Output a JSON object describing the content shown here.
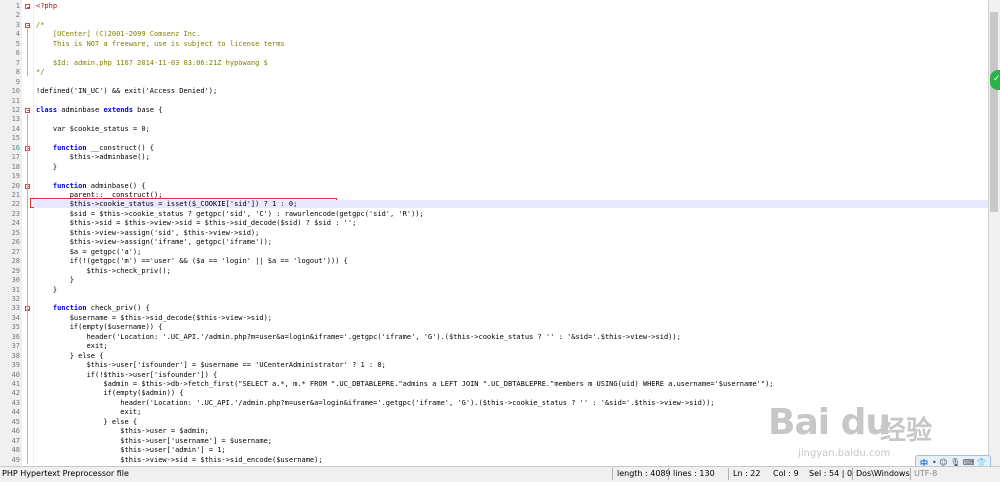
{
  "editor": {
    "lines": [
      {
        "n": "1",
        "t": "<?php",
        "c": "php"
      },
      {
        "n": "2",
        "t": "",
        "c": ""
      },
      {
        "n": "3",
        "t": "/*",
        "c": "com"
      },
      {
        "n": "4",
        "t": "    [UCenter] (C)2001-2099 Comsenz Inc.",
        "c": "com"
      },
      {
        "n": "5",
        "t": "    This is NOT a freeware, use is subject to license terms",
        "c": "com"
      },
      {
        "n": "6",
        "t": "",
        "c": ""
      },
      {
        "n": "7",
        "t": "    $Id: admin.php 1167 2014-11-03 03:06:21Z hypowang $",
        "c": "com"
      },
      {
        "n": "8",
        "t": "*/",
        "c": "com"
      },
      {
        "n": "9",
        "t": "",
        "c": ""
      },
      {
        "n": "10",
        "t": "!defined('IN_UC') && exit('Access Denied');",
        "c": ""
      },
      {
        "n": "11",
        "t": "",
        "c": ""
      },
      {
        "n": "12",
        "t": "class adminbase extends base {",
        "c": "kw"
      },
      {
        "n": "13",
        "t": "",
        "c": ""
      },
      {
        "n": "14",
        "t": "    var $cookie_status = 0;",
        "c": ""
      },
      {
        "n": "15",
        "t": "",
        "c": ""
      },
      {
        "n": "16",
        "t": "    function __construct() {",
        "c": "kw"
      },
      {
        "n": "17",
        "t": "        $this->adminbase();",
        "c": ""
      },
      {
        "n": "18",
        "t": "    }",
        "c": ""
      },
      {
        "n": "19",
        "t": "",
        "c": ""
      },
      {
        "n": "20",
        "t": "    function adminbase() {",
        "c": "kw"
      },
      {
        "n": "21",
        "t": "        parent::__construct();",
        "c": ""
      },
      {
        "n": "22",
        "t": "        $this->cookie_status = isset($_COOKIE['sid']) ? 1 : 0;",
        "c": ""
      },
      {
        "n": "23",
        "t": "        $sid = $this->cookie_status ? getgpc('sid', 'C') : rawurlencode(getgpc('sid', 'R'));",
        "c": ""
      },
      {
        "n": "24",
        "t": "        $this->sid = $this->view->sid = $this->sid_decode($sid) ? $sid : '';",
        "c": ""
      },
      {
        "n": "25",
        "t": "        $this->view->assign('sid', $this->view->sid);",
        "c": ""
      },
      {
        "n": "26",
        "t": "        $this->view->assign('iframe', getgpc('iframe'));",
        "c": ""
      },
      {
        "n": "27",
        "t": "        $a = getgpc('a');",
        "c": ""
      },
      {
        "n": "28",
        "t": "        if(!(getgpc('m') =='user' && ($a == 'login' || $a == 'logout'))) {",
        "c": ""
      },
      {
        "n": "29",
        "t": "            $this->check_priv();",
        "c": ""
      },
      {
        "n": "30",
        "t": "        }",
        "c": ""
      },
      {
        "n": "31",
        "t": "    }",
        "c": ""
      },
      {
        "n": "32",
        "t": "",
        "c": ""
      },
      {
        "n": "33",
        "t": "    function check_priv() {",
        "c": "kw"
      },
      {
        "n": "34",
        "t": "        $username = $this->sid_decode($this->view->sid);",
        "c": ""
      },
      {
        "n": "35",
        "t": "        if(empty($username)) {",
        "c": ""
      },
      {
        "n": "36",
        "t": "            header('Location: '.UC_API.'/admin.php?m=user&a=login&iframe='.getgpc('iframe', 'G').($this->cookie_status ? '' : '&sid='.$this->view->sid));",
        "c": ""
      },
      {
        "n": "37",
        "t": "            exit;",
        "c": ""
      },
      {
        "n": "38",
        "t": "        } else {",
        "c": ""
      },
      {
        "n": "39",
        "t": "            $this->user['isfounder'] = $username == 'UCenterAdministrator' ? 1 : 0;",
        "c": ""
      },
      {
        "n": "40",
        "t": "            if(!$this->user['isfounder']) {",
        "c": ""
      },
      {
        "n": "41",
        "t": "                $admin = $this->db->fetch_first(\"SELECT a.*, m.* FROM \".UC_DBTABLEPRE.\"admins a LEFT JOIN \".UC_DBTABLEPRE.\"members m USING(uid) WHERE a.username='$username'\");",
        "c": ""
      },
      {
        "n": "42",
        "t": "                if(empty($admin)) {",
        "c": ""
      },
      {
        "n": "43",
        "t": "                    header('Location: '.UC_API.'/admin.php?m=user&a=login&iframe='.getgpc('iframe', 'G').($this->cookie_status ? '' : '&sid='.$this->view->sid));",
        "c": ""
      },
      {
        "n": "44",
        "t": "                    exit;",
        "c": ""
      },
      {
        "n": "45",
        "t": "                } else {",
        "c": ""
      },
      {
        "n": "46",
        "t": "                    $this->user = $admin;",
        "c": ""
      },
      {
        "n": "47",
        "t": "                    $this->user['username'] = $username;",
        "c": ""
      },
      {
        "n": "48",
        "t": "                    $this->user['admin'] = 1;",
        "c": ""
      },
      {
        "n": "49",
        "t": "                    $this->view->sid = $this->sid_encode($username);",
        "c": ""
      }
    ],
    "current_line": "22"
  },
  "statusbar": {
    "filetype": "PHP Hypertext Preprocessor file",
    "length": "length : 4089",
    "lines": "lines : 130",
    "position": "Ln : 22",
    "column": "Col : 9",
    "selection": "Sel : 54 | 0",
    "eol": "Dos\\Windows",
    "encoding": "UTF-8"
  },
  "watermark": {
    "logo": "Bai du",
    "logo_cn": "经验",
    "url": "jingyan.baidu.com"
  },
  "ime": {
    "lang": "中",
    "items": "• ☺ 🎙 ⌨ 👕"
  },
  "colors": {
    "php_tag": "#c00000",
    "comment": "#808000",
    "keyword": "#0000e0",
    "highlight": "#e8e8ff",
    "annotation_box": "#e53030"
  }
}
